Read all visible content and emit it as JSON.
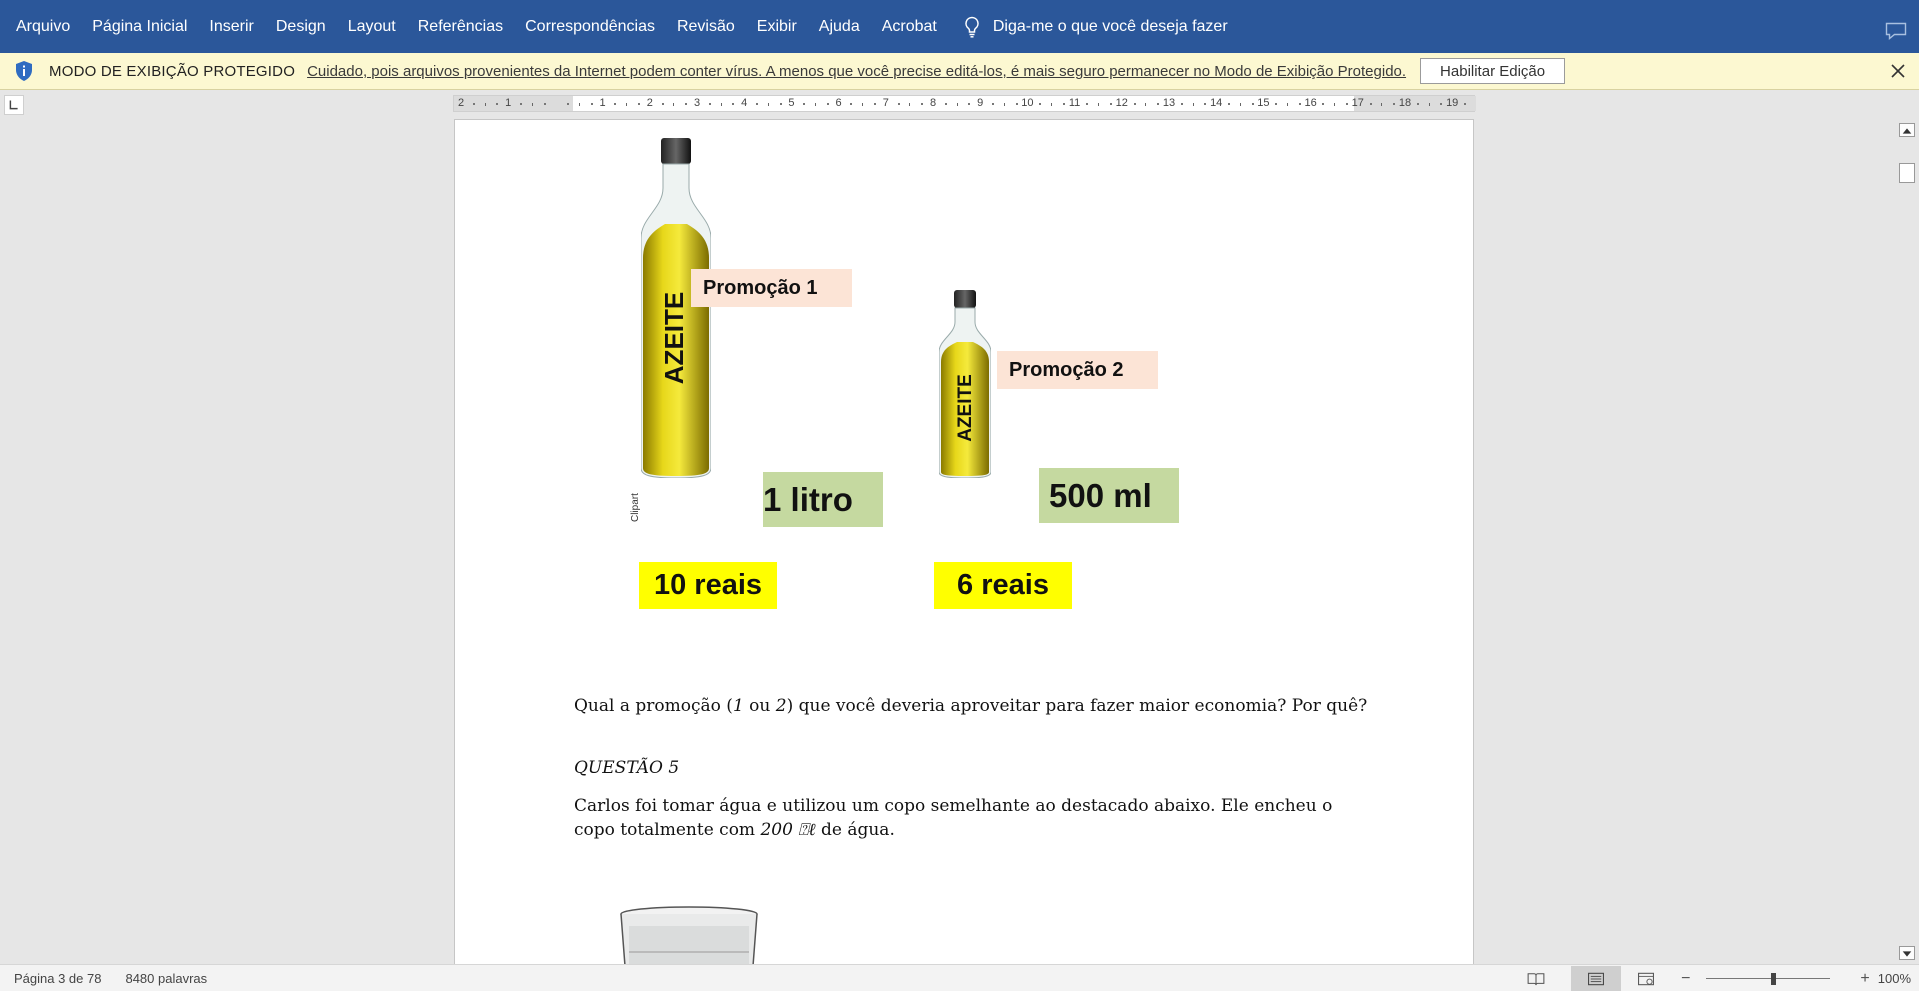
{
  "menu": {
    "items": [
      "Arquivo",
      "Página Inicial",
      "Inserir",
      "Design",
      "Layout",
      "Referências",
      "Correspondências",
      "Revisão",
      "Exibir",
      "Ajuda",
      "Acrobat"
    ],
    "tell_me": "Diga-me o que você deseja fazer"
  },
  "protected_view": {
    "title": "MODO DE EXIBIÇÃO PROTEGIDO",
    "message": "Cuidado, pois arquivos provenientes da Internet podem conter vírus. A menos que você precise editá-los, é mais seguro permanecer no Modo de  Exibição Protegido.",
    "enable_button": "Habilitar Edição"
  },
  "ruler": {
    "labels": [
      "2",
      "1",
      "",
      "1",
      "2",
      "3",
      "4",
      "5",
      "6",
      "7",
      "8",
      "9",
      "10",
      "11",
      "12",
      "13",
      "14",
      "15",
      "16",
      "17",
      "18",
      "19"
    ]
  },
  "document": {
    "promo1": "Promoção 1",
    "promo2": "Promoção 2",
    "volume1": "1 litro",
    "volume2": "500 ml",
    "price1": "10 reais",
    "price2": "6 reais",
    "bottle_text": "AZEITE",
    "clipart": "Clipart",
    "question_part1": "Qual a promoção (",
    "question_opt1": "1",
    "question_part2": " ou ",
    "question_opt2": "2",
    "question_part3": ") que você deveria aproveitar para fazer maior economia? Por quê?",
    "q5_heading": "QUESTÃO 5",
    "q5_line1": "Carlos foi tomar água e utilizou um copo semelhante ao destacado abaixo. Ele encheu o",
    "q5_line2_a": "copo totalmente com ",
    "q5_line2_value": "200 ⍰ℓ",
    "q5_line2_b": " de água."
  },
  "status": {
    "page": "Página 3 de 78",
    "words": "8480 palavras",
    "zoom": "100%"
  },
  "colors": {
    "ribbon": "#2b579a",
    "protected_bar": "#fcf8d1",
    "promo_bg": "#fce4d6",
    "volume_bg": "#c5d9a0",
    "price_bg": "#ffff00",
    "oil": "#d8c400"
  }
}
